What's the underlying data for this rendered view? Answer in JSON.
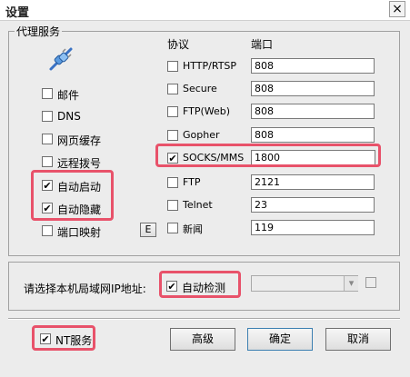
{
  "window": {
    "title": "设置",
    "close_glyph": "×"
  },
  "proxy_group": {
    "legend": "代理服务",
    "protocol_header": "协议",
    "port_header": "端口",
    "left_options": [
      {
        "label": "邮件",
        "checked": false
      },
      {
        "label": "DNS",
        "checked": false
      },
      {
        "label": "网页缓存",
        "checked": false
      },
      {
        "label": "远程拨号",
        "checked": false
      },
      {
        "label": "自动启动",
        "checked": true
      },
      {
        "label": "自动隐藏",
        "checked": true
      },
      {
        "label": "端口映射",
        "checked": false
      }
    ],
    "e_button": "E",
    "protocols": [
      {
        "label": "HTTP/RTSP",
        "checked": false,
        "port": "808"
      },
      {
        "label": "Secure",
        "checked": false,
        "port": "808"
      },
      {
        "label": "FTP(Web)",
        "checked": false,
        "port": "808"
      },
      {
        "label": "Gopher",
        "checked": false,
        "port": "808"
      },
      {
        "label": "SOCKS/MMS",
        "checked": true,
        "port": "1800"
      },
      {
        "label": "FTP",
        "checked": false,
        "port": "2121"
      },
      {
        "label": "Telnet",
        "checked": false,
        "port": "23"
      },
      {
        "label": "新闻",
        "checked": false,
        "port": "119"
      }
    ]
  },
  "lan": {
    "prompt": "请选择本机局域网IP地址:",
    "auto_detect_label": "自动检测",
    "auto_detect_checked": true,
    "dropdown_value": "",
    "dropdown_arrow": "▾"
  },
  "footer": {
    "nt_service_label": "NT服务",
    "nt_service_checked": true,
    "advanced_button": "高级",
    "ok_button": "确定",
    "cancel_button": "取消"
  },
  "check_glyph": "✔",
  "colors": {
    "highlight": "#e8526a",
    "background": "#ececec",
    "icon": "#3a72c4"
  }
}
